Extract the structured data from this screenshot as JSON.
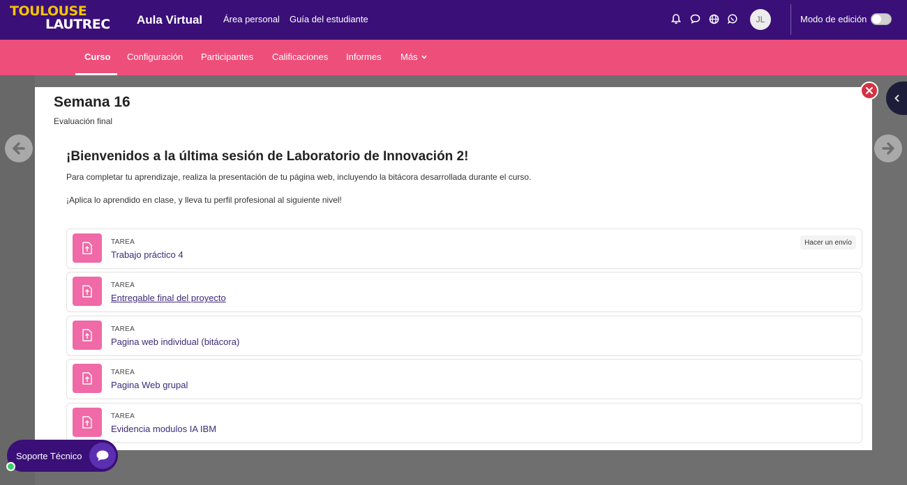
{
  "header": {
    "logo_line1": "TOULOUSE",
    "logo_line2": "LAUTREC",
    "site_name": "Aula Virtual",
    "nav": [
      "Área personal",
      "Guía del estudiante"
    ],
    "icons": [
      "bell-icon",
      "chat-icon",
      "globe-icon",
      "whatsapp-icon"
    ],
    "avatar_initials": "JL",
    "edit_mode_label": "Modo de edición",
    "edit_mode_on": false
  },
  "course_nav": {
    "items": [
      "Curso",
      "Configuración",
      "Participantes",
      "Calificaciones",
      "Informes",
      "Más"
    ],
    "active": "Curso"
  },
  "modal": {
    "title": "Semana 16",
    "subtitle": "Evaluación final",
    "heading": "¡Bienvenidos a la última sesión de Laboratorio de Innovación 2!",
    "paragraph1": "Para completar tu aprendizaje, realiza la presentación de tu página web, incluyendo la bitácora desarrollada durante el curso.",
    "paragraph2": "¡Aplica lo aprendido en clase, y lleva tu perfil profesional al siguiente nivel!",
    "activities": [
      {
        "type": "TAREA",
        "name": "Trabajo práctico 4",
        "badge": "Hacer un envío"
      },
      {
        "type": "TAREA",
        "name": "Entregable final del proyecto"
      },
      {
        "type": "TAREA",
        "name": "Pagina web individual (bitácora)"
      },
      {
        "type": "TAREA",
        "name": "Pagina Web grupal"
      },
      {
        "type": "TAREA",
        "name": "Evidencia modulos IA IBM"
      }
    ]
  },
  "support": {
    "label": "Soporte Técnico"
  },
  "colors": {
    "header": "#3a0f78",
    "course_nav": "#ee4e7a",
    "activity_icon": "#ef6aa6",
    "close": "#d63043"
  }
}
